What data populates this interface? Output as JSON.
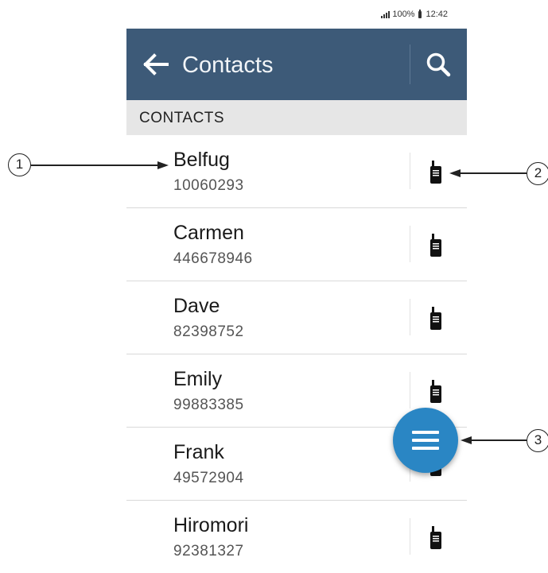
{
  "status_bar": {
    "battery": "100%",
    "time": "12:42",
    "icons": [
      "signal-icon",
      "battery-icon"
    ]
  },
  "app_bar": {
    "title": "Contacts",
    "back_icon": "back-arrow-icon",
    "search_icon": "search-icon",
    "background": "#3d5a78"
  },
  "section": {
    "header": "CONTACTS"
  },
  "contacts": [
    {
      "name": "Belfug",
      "number": "10060293"
    },
    {
      "name": "Carmen",
      "number": "446678946"
    },
    {
      "name": "Dave",
      "number": "82398752"
    },
    {
      "name": "Emily",
      "number": "99883385"
    },
    {
      "name": "Frank",
      "number": "49572904"
    },
    {
      "name": "Hiromori",
      "number": "92381327"
    }
  ],
  "fab": {
    "icon": "menu-icon",
    "color": "#2a86c4"
  },
  "callouts": [
    "1",
    "2",
    "3"
  ]
}
